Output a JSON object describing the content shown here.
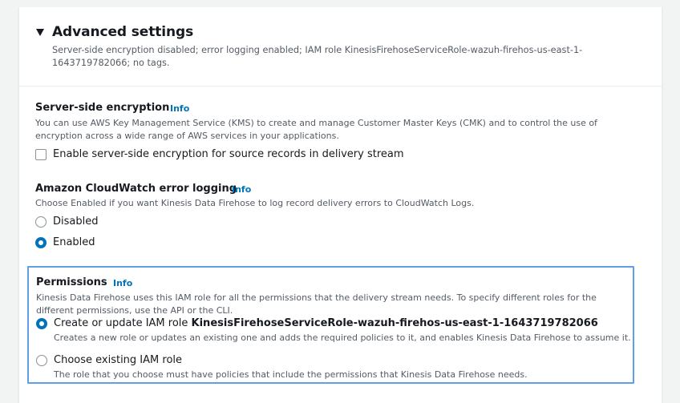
{
  "advanced": {
    "title": "Advanced settings",
    "summary": "Server-side encryption disabled; error logging enabled; IAM role KinesisFirehoseServiceRole-wazuh-firehos-us-east-1-1643719782066; no tags."
  },
  "sse": {
    "label": "Server-side encryption",
    "info": "Info",
    "description": "You can use AWS Key Management Service (KMS) to create and manage Customer Master Keys (CMK) and to control the use of encryption across a wide range of AWS services in your applications.",
    "checkbox_label": "Enable server-side encryption for source records in delivery stream",
    "checked": false
  },
  "logging": {
    "label": "Amazon CloudWatch error logging",
    "info": "Info",
    "description": "Choose Enabled if you want Kinesis Data Firehose to log record delivery errors to CloudWatch Logs.",
    "options": [
      {
        "label": "Disabled",
        "selected": false
      },
      {
        "label": "Enabled",
        "selected": true
      }
    ]
  },
  "permissions": {
    "label": "Permissions",
    "info": "Info",
    "description": "Kinesis Data Firehose uses this IAM role for all the permissions that the delivery stream needs. To specify different roles for the different permissions, use the API or the CLI.",
    "options": [
      {
        "label_prefix": "Create or update IAM role ",
        "label_bold": "KinesisFirehoseServiceRole-wazuh-firehos-us-east-1-1643719782066",
        "description": "Creates a new role or updates an existing one and adds the required policies to it, and enables Kinesis Data Firehose to assume it.",
        "selected": true
      },
      {
        "label_prefix": "Choose existing IAM role",
        "label_bold": "",
        "description": "The role that you choose must have policies that include the permissions that Kinesis Data Firehose needs.",
        "selected": false
      }
    ]
  },
  "colors": {
    "accent": "#0073bb",
    "focus_border": "#5f9ee8",
    "secondary_text": "#545b64",
    "background": "#f2f3f3"
  }
}
